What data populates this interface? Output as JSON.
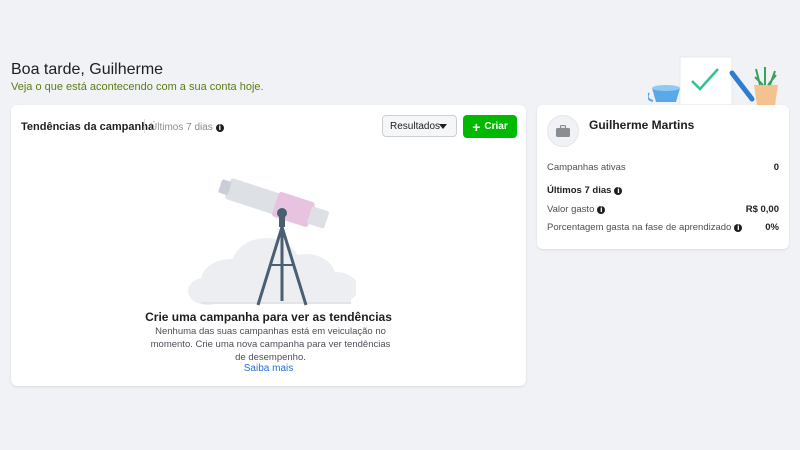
{
  "header": {
    "greeting": "Boa tarde, Guilherme",
    "subtitle": "Veja o que está acontecendo com a sua conta hoje."
  },
  "trends": {
    "title": "Tendências da campanha",
    "period": "Últimos 7 dias",
    "dropdown_value": "Resultados",
    "create_label": "Criar",
    "empty_title": "Crie uma campanha para ver as tendências",
    "empty_description": "Nenhuma das suas campanhas está em veiculação no momento. Crie uma nova campanha para ver tendências de desempenho.",
    "learn_more": "Saiba mais"
  },
  "account": {
    "name": "Guilherme Martins",
    "active_campaigns_label": "Campanhas ativas",
    "active_campaigns_value": "0",
    "period_heading": "Últimos 7 dias",
    "amount_spent_label": "Valor gasto",
    "amount_spent_value": "R$ 0,00",
    "learning_spend_label": "Porcentagem gasta na fase de aprendizado",
    "learning_spend_value": "0%"
  },
  "colors": {
    "create_button": "#00b900",
    "link": "#216fdb",
    "subtitle": "#5b7c12",
    "background": "#f0f2f5"
  },
  "icons": {
    "info": "info-icon",
    "caret": "caret-down-icon",
    "plus": "plus-icon",
    "avatar": "briefcase-icon"
  }
}
